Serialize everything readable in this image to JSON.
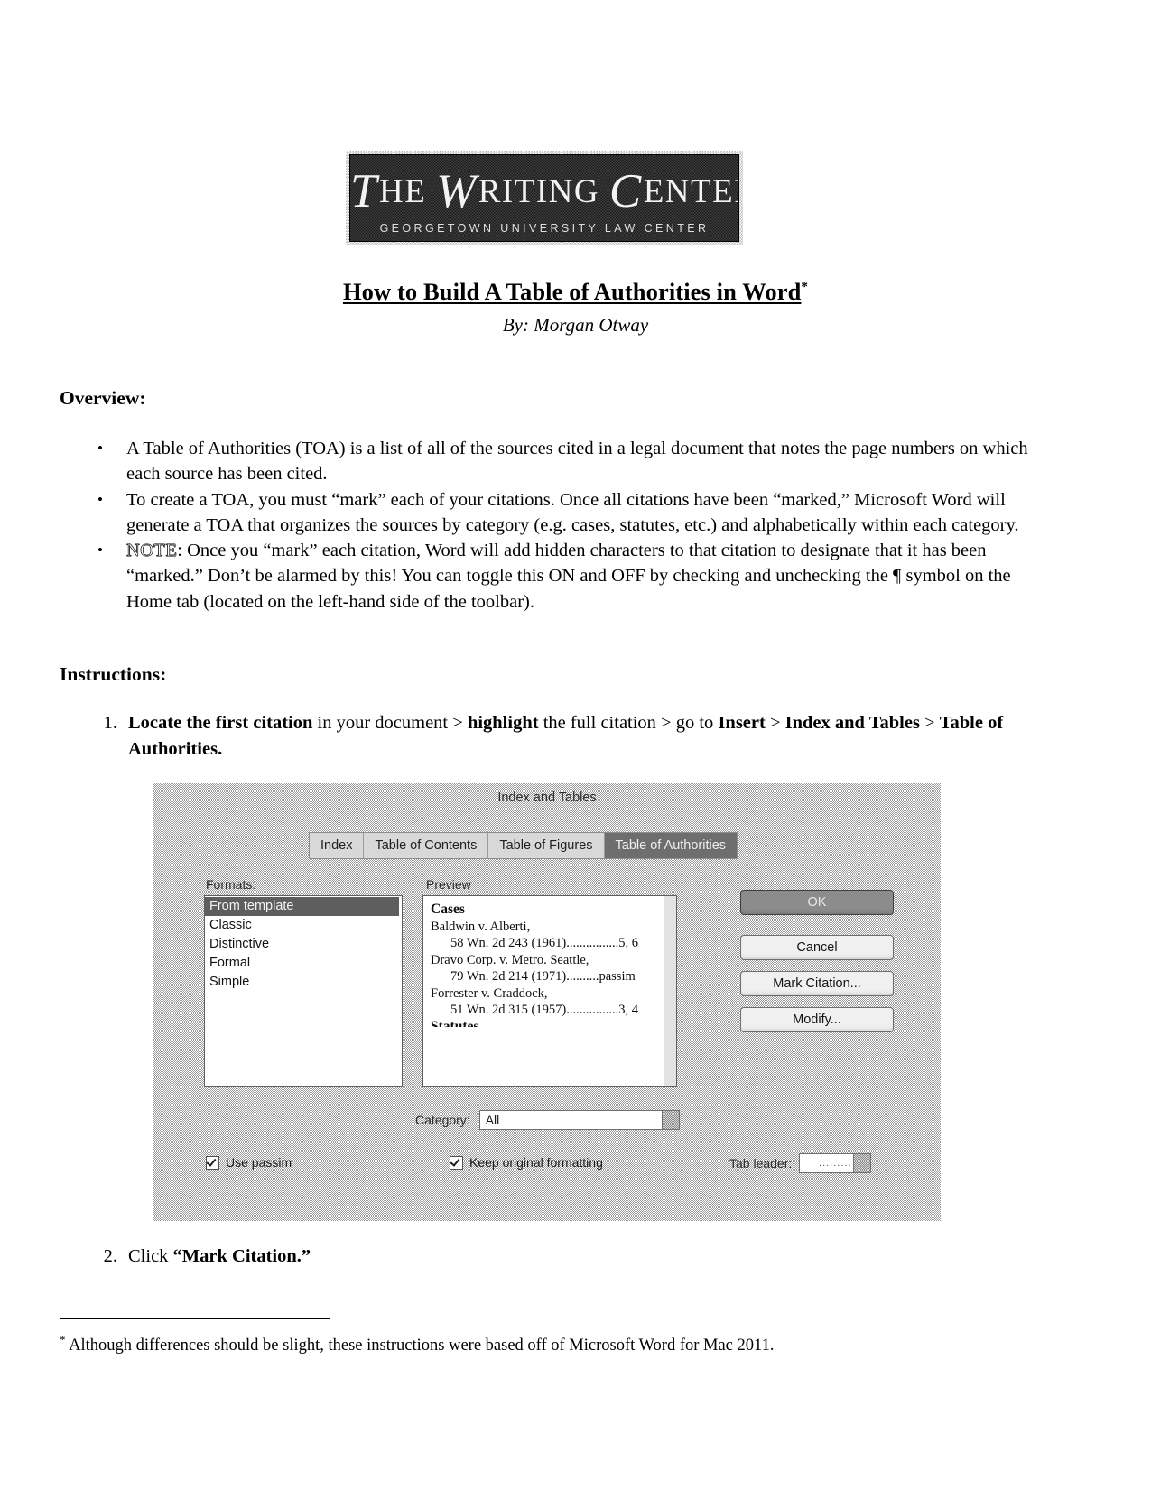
{
  "logo": {
    "line1_the": "T",
    "title_parts": [
      "T",
      "HE ",
      "W",
      "RITING ",
      "C",
      "ENTER"
    ],
    "title_full": "THE WRITING CENTER",
    "subtitle": "GEORGETOWN UNIVERSITY LAW CENTER"
  },
  "title": {
    "main": "How to Build A Table of Authorities in Word",
    "footnote_marker": "*",
    "byline": "By: Morgan Otway"
  },
  "sections": {
    "overview_heading": "Overview:",
    "instructions_heading": "Instructions:"
  },
  "overview_bullets": [
    {
      "marker": "•",
      "text": "A Table of Authorities (TOA) is a list of all of the sources cited in a legal document that notes the page numbers on which each source has been cited."
    },
    {
      "marker": "•",
      "text": "To create a TOA, you must “mark” each of your citations. Once all citations have been “marked,” Microsoft Word will generate a TOA that organizes the sources by category (e.g. cases, statutes, etc.) and alphabetically within each category."
    },
    {
      "marker": "•",
      "label": "NOTE",
      "text": ": Once you “mark” each citation, Word will add hidden characters to that citation to designate that it has been “marked.” Don’t be alarmed by this! You can toggle this ON and OFF by checking and unchecking the ¶ symbol on the Home tab (located on the left-hand side of the toolbar)."
    }
  ],
  "steps": {
    "step1": {
      "number": "1.",
      "part1_bold": "Locate the first citation",
      "part2": " in your document > ",
      "part3_bold": "highlight",
      "part4": " the full citation > go to ",
      "part5_bold": "Insert",
      "part6": " > ",
      "part7_bold": "Index and Tables",
      "part8": " > ",
      "part9_bold": "Table of Authorities."
    },
    "step2": {
      "number": "2.",
      "text_plain": "Click ",
      "text_bold": "“Mark Citation.”"
    }
  },
  "dialog": {
    "title": "Index and Tables",
    "tabs": [
      {
        "label": "Index",
        "active": false
      },
      {
        "label": "Table of Contents",
        "active": false
      },
      {
        "label": "Table of Figures",
        "active": false
      },
      {
        "label": "Table of Authorities",
        "active": true
      }
    ],
    "formats_label": "Formats:",
    "formats": [
      {
        "label": "From template",
        "selected": true
      },
      {
        "label": "Classic",
        "selected": false
      },
      {
        "label": "Distinctive",
        "selected": false
      },
      {
        "label": "Formal",
        "selected": false
      },
      {
        "label": "Simple",
        "selected": false
      }
    ],
    "preview_label": "Preview",
    "preview": {
      "heading": "Cases",
      "entries": [
        {
          "case": "Baldwin v. Alberti,",
          "cite": "58 Wn. 2d 243 (1961)",
          "leader": "................",
          "pages": "5, 6"
        },
        {
          "case": "Dravo Corp. v. Metro. Seattle,",
          "cite": "79 Wn. 2d 214 (1971)",
          "leader": "..........",
          "pages": "passim"
        },
        {
          "case": "Forrester v. Craddock,",
          "cite": "51 Wn. 2d 315 (1957)",
          "leader": "................",
          "pages": "3, 4"
        }
      ],
      "next_heading": "Statutes"
    },
    "buttons": {
      "ok": "OK",
      "cancel": "Cancel",
      "mark_citation": "Mark Citation...",
      "modify": "Modify..."
    },
    "category": {
      "label": "Category:",
      "value": "All"
    },
    "options": {
      "use_passim": {
        "label": "Use passim",
        "checked": true
      },
      "keep_original_formatting": {
        "label": "Keep original formatting",
        "checked": true
      },
      "tab_leader": {
        "label": "Tab leader:",
        "value": "........."
      }
    }
  },
  "footnote": {
    "marker": "*",
    "text": "Although differences should be slight, these instructions were based off of Microsoft Word for Mac 2011."
  }
}
